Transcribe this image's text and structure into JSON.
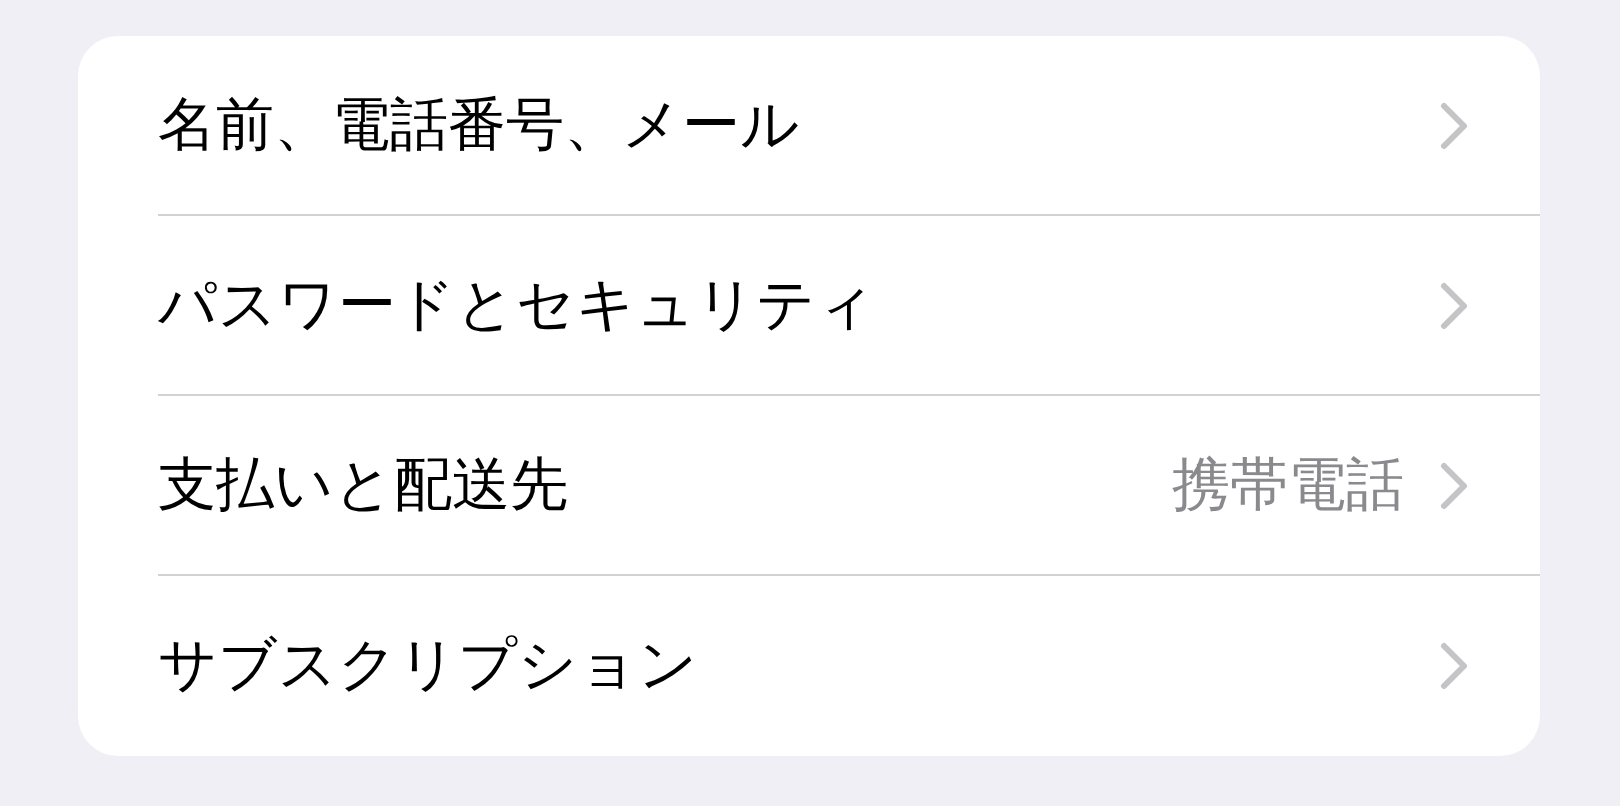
{
  "settings_list": [
    {
      "label": "名前、電話番号、メール"
    },
    {
      "label": "パスワードとセキュリティ"
    },
    {
      "label": "支払いと配送先",
      "value": "携帯電話"
    },
    {
      "label": "サブスクリプション"
    }
  ]
}
